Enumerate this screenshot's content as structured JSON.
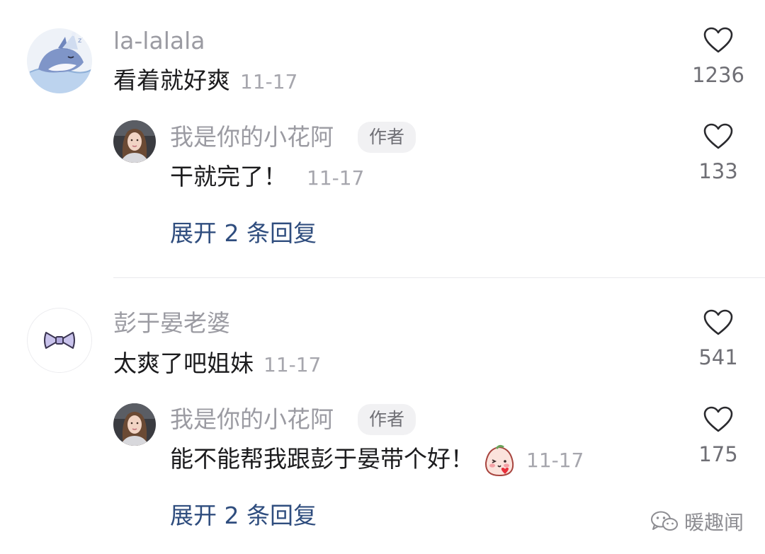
{
  "threads": [
    {
      "comment": {
        "username": "la-lalala",
        "text": "看着就好爽",
        "date": "11-17",
        "likes": "1236",
        "avatar": "shark-in-bed-avatar"
      },
      "reply": {
        "username": "我是你的小花阿",
        "badge": "作者",
        "text": "干就完了！",
        "date": "11-17",
        "likes": "133",
        "avatar": "girl-photo-avatar"
      },
      "expand_label": "展开 2 条回复"
    },
    {
      "comment": {
        "username": "彭于晏老婆",
        "text": "太爽了吧姐妹",
        "date": "11-17",
        "likes": "541",
        "avatar": "purple-bow-avatar"
      },
      "reply": {
        "username": "我是你的小花阿",
        "badge": "作者",
        "text": "能不能帮我跟彭于晏带个好！",
        "emoji": "blush-heart-sticker",
        "date": "11-17",
        "likes": "175",
        "avatar": "girl-photo-avatar"
      },
      "expand_label": "展开 2 条回复"
    }
  ],
  "watermark": {
    "text": "暖趣闻",
    "icon": "wechat-logo-icon"
  },
  "icons": {
    "like": "heart-outline-icon"
  },
  "colors": {
    "link": "#2f4d7e",
    "username": "#9b9ba2",
    "text": "#1c1c1e",
    "badge_bg": "#f1f1f3"
  }
}
